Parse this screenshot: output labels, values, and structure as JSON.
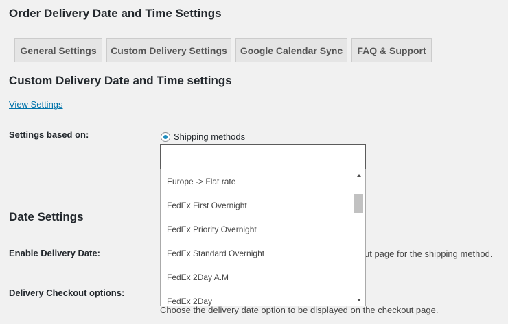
{
  "page_title": "Order Delivery Date and Time Settings",
  "tabs": [
    {
      "label": "General Settings"
    },
    {
      "label": "Custom Delivery Settings"
    },
    {
      "label": "Google Calendar Sync"
    },
    {
      "label": "FAQ & Support"
    }
  ],
  "section_title": "Custom Delivery Date and Time settings",
  "view_settings_link": "View Settings",
  "settings_based_on": {
    "label": "Settings based on:",
    "radio_label": "Shipping methods",
    "selected": true,
    "input_value": ""
  },
  "dropdown": {
    "options": [
      "Europe -> Flat rate",
      "FedEx First Overnight",
      "FedEx Priority Overnight",
      "FedEx Standard Overnight",
      "FedEx 2Day A.M",
      "FedEx 2Day"
    ]
  },
  "date_settings": {
    "title": "Date Settings",
    "enable_delivery_date_label": "Enable Delivery Date:",
    "enable_delivery_date_desc_visible": "ut page for the shipping method.",
    "delivery_checkout_options_label": "Delivery Checkout options:",
    "delivery_checkout_options_desc": "Choose the delivery date option to be displayed on the checkout page."
  },
  "colors": {
    "background": "#f1f1f1",
    "link": "#0073aa",
    "radio_selected": "#1e8cbe"
  }
}
